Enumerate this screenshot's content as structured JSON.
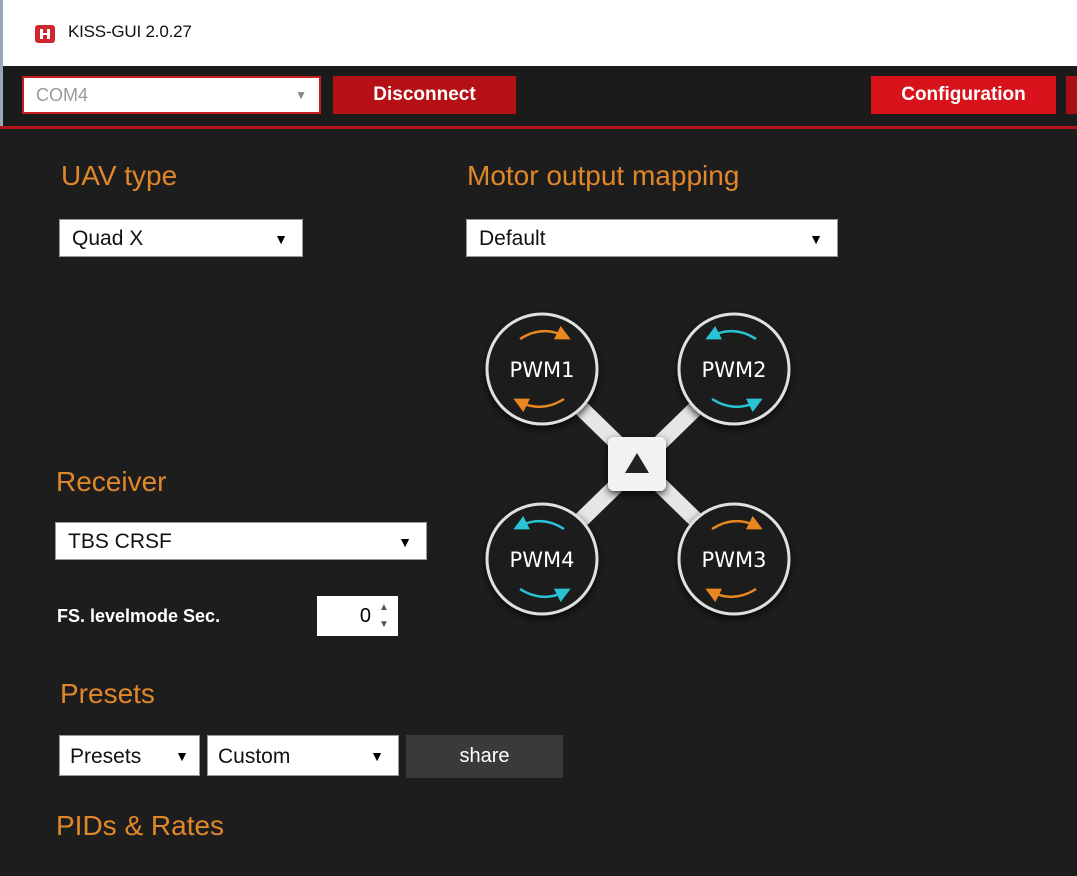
{
  "window": {
    "title": "KISS-GUI 2.0.27",
    "icon": "kiss-app-icon"
  },
  "toolbar": {
    "port_value": "COM4",
    "disconnect_label": "Disconnect",
    "configuration_label": "Configuration"
  },
  "uav": {
    "title": "UAV type",
    "value": "Quad X"
  },
  "motor_mapping": {
    "title": "Motor output mapping",
    "value": "Default"
  },
  "receiver": {
    "title": "Receiver",
    "value": "TBS CRSF",
    "fs_label": "FS. levelmode Sec.",
    "fs_value": "0"
  },
  "presets": {
    "title": "Presets",
    "presets_value": "Presets",
    "custom_value": "Custom",
    "share_label": "share"
  },
  "pids": {
    "title": "PIDs & Rates"
  },
  "diagram": {
    "motors": [
      "PWM1",
      "PWM2",
      "PWM3",
      "PWM4"
    ],
    "colors": {
      "cw": "#e8871f",
      "ccw": "#29c3d3"
    }
  },
  "colors": {
    "accent": "#e0872a",
    "red": "#b51016",
    "background": "#1d1d1d"
  }
}
